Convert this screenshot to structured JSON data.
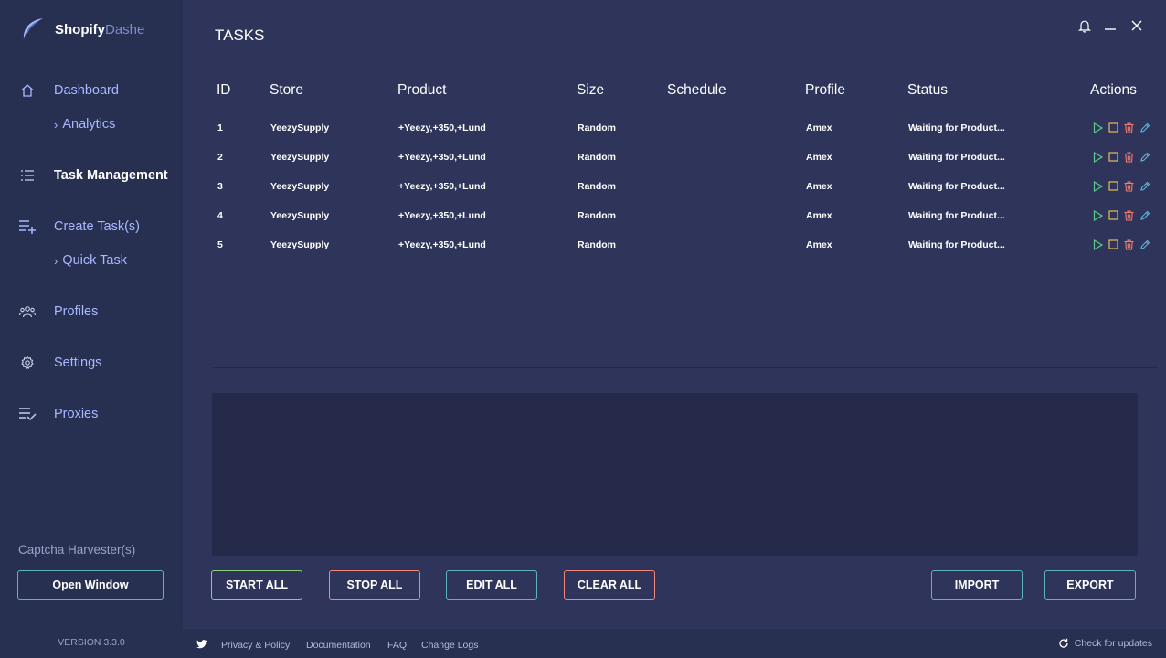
{
  "app": {
    "brand_main": "Shopify",
    "brand_accent": "Dashe",
    "version": "VERSION 3.3.0"
  },
  "sidebar": {
    "items": [
      {
        "label": "Dashboard",
        "icon": "home-icon"
      },
      {
        "label": "Task Management",
        "icon": "list-icon"
      },
      {
        "label": "Create Task(s)",
        "icon": "playlist-add-icon"
      },
      {
        "label": "Profiles",
        "icon": "users-icon"
      },
      {
        "label": "Settings",
        "icon": "gear-icon"
      },
      {
        "label": "Proxies",
        "icon": "playlist-check-icon"
      }
    ],
    "subitems": {
      "analytics": "Analytics",
      "quick_task": "Quick Task"
    },
    "captcha_title": "Captcha Harvester(s)",
    "open_window": "Open Window"
  },
  "main": {
    "title": "TASKS",
    "columns": [
      "ID",
      "Store",
      "Product",
      "Size",
      "Schedule",
      "Profile",
      "Status",
      "Actions"
    ],
    "rows": [
      {
        "id": "1",
        "store": "YeezySupply",
        "product": "+Yeezy,+350,+Lund",
        "size": "Random",
        "schedule": "",
        "profile": "Amex",
        "status": "Waiting for Product..."
      },
      {
        "id": "2",
        "store": "YeezySupply",
        "product": "+Yeezy,+350,+Lund",
        "size": "Random",
        "schedule": "",
        "profile": "Amex",
        "status": "Waiting for Product..."
      },
      {
        "id": "3",
        "store": "YeezySupply",
        "product": "+Yeezy,+350,+Lund",
        "size": "Random",
        "schedule": "",
        "profile": "Amex",
        "status": "Waiting for Product..."
      },
      {
        "id": "4",
        "store": "YeezySupply",
        "product": "+Yeezy,+350,+Lund",
        "size": "Random",
        "schedule": "",
        "profile": "Amex",
        "status": "Waiting for Product..."
      },
      {
        "id": "5",
        "store": "YeezySupply",
        "product": "+Yeezy,+350,+Lund",
        "size": "Random",
        "schedule": "",
        "profile": "Amex",
        "status": "Waiting for Product..."
      }
    ],
    "buttons": {
      "start_all": "START ALL",
      "stop_all": "STOP ALL",
      "edit_all": "EDIT ALL",
      "clear_all": "CLEAR ALL",
      "import": "IMPORT",
      "export": "EXPORT"
    }
  },
  "footer": {
    "links": [
      "Privacy & Policy",
      "Documentation",
      "FAQ",
      "Change Logs"
    ],
    "check_updates": "Check for updates"
  },
  "colors": {
    "background": "#2f355a",
    "sidebar": "#283052",
    "log_area": "#252a4a",
    "accent": "#a9b8ff",
    "start": "#8bd17c",
    "stop": "#f2867a",
    "edit": "#5fb3bd",
    "play_icon": "#5cc98a",
    "stop_icon": "#e6b85c",
    "delete_icon": "#f07a6e",
    "edit_icon": "#5fb3d9"
  }
}
